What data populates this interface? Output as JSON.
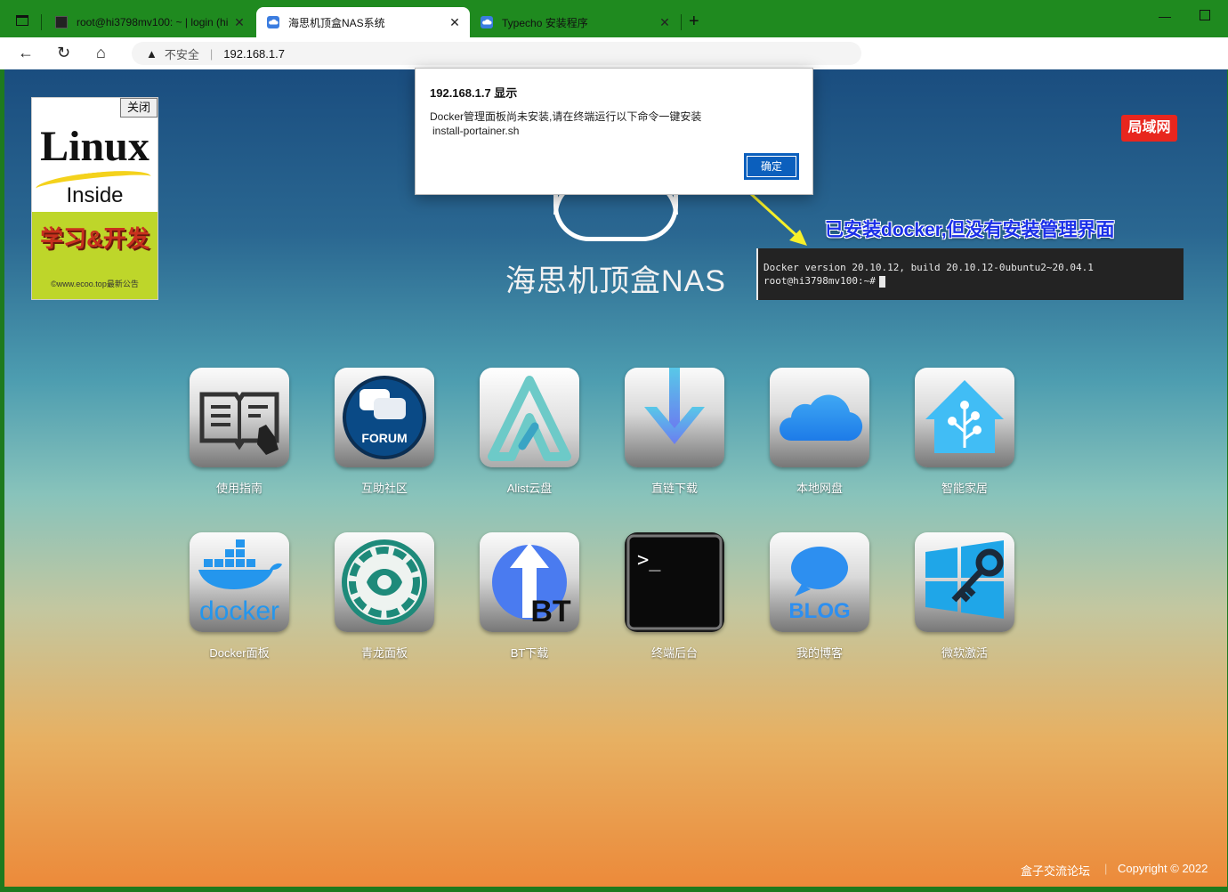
{
  "browser": {
    "tabs": [
      {
        "label": "root@hi3798mv100: ~ | login (hi",
        "active": false
      },
      {
        "label": "海思机顶盒NAS系统",
        "active": true
      },
      {
        "label": "Typecho 安装程序",
        "active": false
      }
    ],
    "insecure_label": "不安全",
    "url": "192.168.1.7"
  },
  "ad": {
    "close_label": "关闭",
    "brand": "Linux",
    "inside": "Inside",
    "slogan": "学习&开发",
    "site": "©www.ecoo.top最新公告"
  },
  "badge_label": "局域网",
  "site_title": "海思机顶盒NAS",
  "annotation": "已安装docker,但没有安装管理界面",
  "terminal": {
    "line1": "Docker version 20.10.12, build 20.10.12-0ubuntu2~20.04.1",
    "line2": "root@hi3798mv100:~#"
  },
  "apps": [
    {
      "label": "使用指南",
      "icon": "book-icon"
    },
    {
      "label": "互助社区",
      "icon": "forum-icon"
    },
    {
      "label": "Alist云盘",
      "icon": "alist-icon"
    },
    {
      "label": "直链下载",
      "icon": "download-arrow-icon"
    },
    {
      "label": "本地网盘",
      "icon": "cloud-icon"
    },
    {
      "label": "智能家居",
      "icon": "home-assistant-icon"
    },
    {
      "label": "Docker面板",
      "icon": "docker-icon"
    },
    {
      "label": "青龙面板",
      "icon": "dragon-icon"
    },
    {
      "label": "BT下载",
      "icon": "bt-icon"
    },
    {
      "label": "终端后台",
      "icon": "terminal-icon"
    },
    {
      "label": "我的博客",
      "icon": "blog-icon"
    },
    {
      "label": "微软激活",
      "icon": "windows-key-icon"
    }
  ],
  "footer": {
    "forum": "盒子交流论坛",
    "copyright": "Copyright © 2022"
  },
  "dialog": {
    "title": "192.168.1.7 显示",
    "message": "Docker管理面板尚未安装,请在终端运行以下命令一键安装",
    "command": "install-portainer.sh",
    "ok_label": "确定"
  },
  "colors": {
    "tabbar": "#1f8a1f",
    "badge": "#e8261e",
    "dialog_button": "#0b5fbd",
    "annotation": "#1a2fe8"
  }
}
